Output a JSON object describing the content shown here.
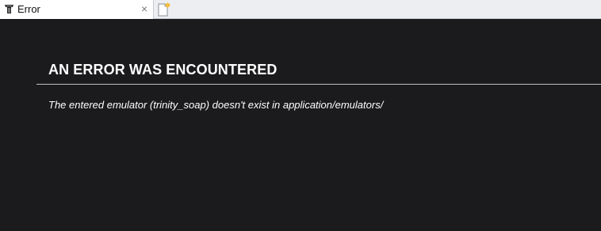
{
  "tab": {
    "title": "Error",
    "close_glyph": "×",
    "icon": "page-favicon-icon"
  },
  "new_tab": {
    "icon": "new-tab-icon"
  },
  "error": {
    "heading": "AN ERROR WAS ENCOUNTERED",
    "message": "The entered emulator (trinity_soap) doesn't exist in application/emulators/"
  },
  "colors": {
    "background": "#1b1b1d",
    "text": "#ffffff",
    "rule": "#bfbfbf"
  }
}
